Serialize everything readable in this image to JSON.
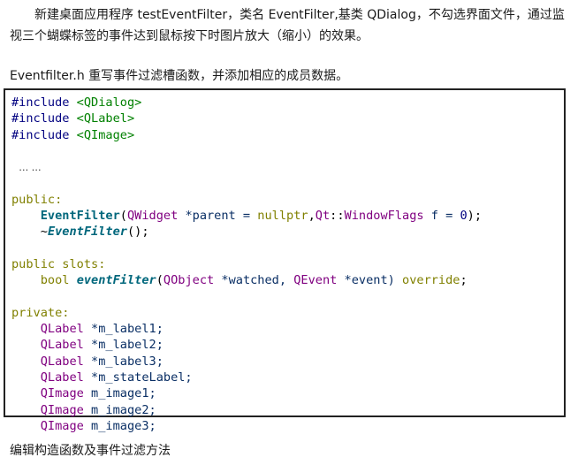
{
  "intro": "新建桌面应用程序 testEventFilter，类名 EventFilter,基类 QDialog，不勾选界面文件，通过监视三个蝴蝶标签的事件达到鼠标按下时图片放大（缩小）的效果。",
  "header_note": "Eventfilter.h 重写事件过滤槽函数，并添加相应的成员数据。",
  "code": {
    "include_kw": "#include",
    "includes": [
      "<QDialog>",
      "<QLabel>",
      "<QImage>"
    ],
    "ellipsis": "… …",
    "public_kw": "public:",
    "ctor_name": "EventFilter",
    "ctor_params": {
      "p1_type": "QWidget",
      "p1_rest": " *parent = ",
      "p1_default": "nullptr",
      "p2_ns": "Qt",
      "p2_sep": "::",
      "p2_type": "WindowFlags",
      "p2_rest": " f = ",
      "p2_default": "0",
      "close": ");"
    },
    "dtor_prefix": "~",
    "dtor_name": "EventFilter",
    "dtor_suffix": "();",
    "slots_kw": "public slots:",
    "slot_ret": "bool",
    "slot_name": "eventFilter",
    "slot_p1_type": "QObject",
    "slot_p1_rest": " *watched, ",
    "slot_p2_type": "QEvent",
    "slot_p2_rest": " *event) ",
    "slot_override": "override",
    "slot_end": ";",
    "private_kw": "private:",
    "members": [
      {
        "type": "QLabel",
        "decl": " *m_label1;"
      },
      {
        "type": "QLabel",
        "decl": " *m_label2;"
      },
      {
        "type": "QLabel",
        "decl": " *m_label3;"
      },
      {
        "type": "QLabel",
        "decl": " *m_stateLabel;"
      },
      {
        "type": "QImage",
        "decl": " m_image1;"
      },
      {
        "type": "QImage",
        "decl": " m_image2;"
      },
      {
        "type": "QImage",
        "decl": " m_image3;"
      }
    ]
  },
  "footer_note": "编辑构造函数及事件过滤方法"
}
